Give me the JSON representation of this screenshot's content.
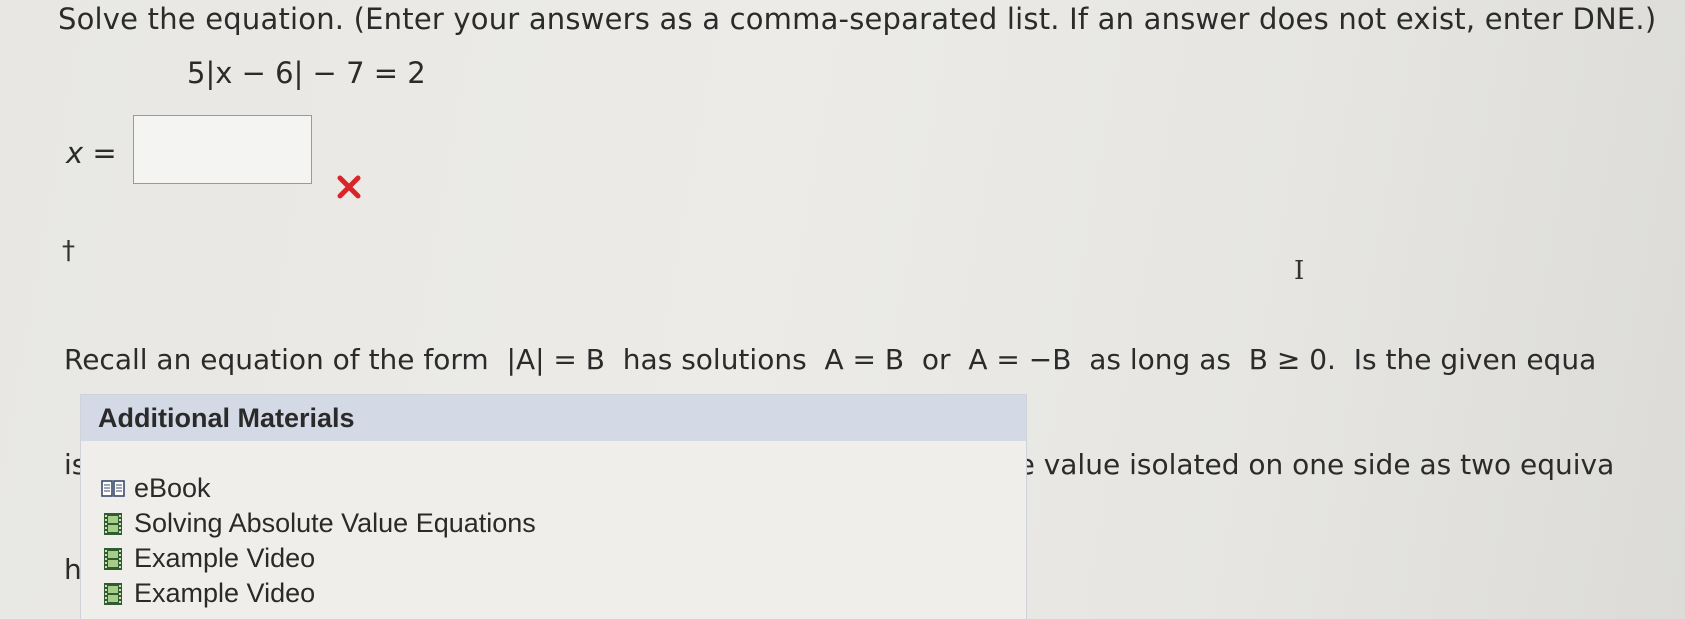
{
  "question": {
    "prompt": "Solve the equation. (Enter your answers as a comma-separated list. If an answer does not exist, enter DNE.)",
    "equation": "5|x − 6| − 7 = 2",
    "answer_label": "x =",
    "answer_value": "",
    "answer_status": "incorrect",
    "status_icon": "red-x-icon",
    "status_color": "#d9252a"
  },
  "hint": {
    "marker": "†",
    "lines": [
      "Recall an equation of the form  |A| = B  has solutions  A = B  or  A = −B  as long as  B ≥ 0.  Is the given equa",
      "isolated on one side? How is rewriting the equation with the absolute value isolated on one side as two equiva",
      "helpful when solving for x?"
    ]
  },
  "additional_materials": {
    "title": "Additional Materials",
    "header_color": "#d3dae6",
    "items": [
      {
        "label": "eBook",
        "icon": "book-icon"
      },
      {
        "label": "Solving Absolute Value Equations",
        "icon": "film-icon"
      },
      {
        "label": "Example Video",
        "icon": "film-icon"
      },
      {
        "label": "Example Video",
        "icon": "film-icon"
      }
    ]
  }
}
